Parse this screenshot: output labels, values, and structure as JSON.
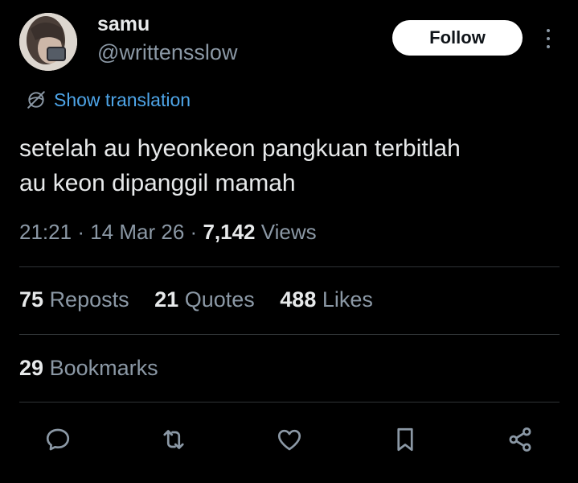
{
  "author": {
    "name": "samu",
    "handle": "@writtensslow",
    "avatar_icon": "profile-photo"
  },
  "follow_label": "Follow",
  "more_icon": "more-vertical-icon",
  "translation": {
    "label": "Show translation",
    "icon": "globe-slash-icon",
    "color": "#4ea5e8"
  },
  "tweet": {
    "line1": "setelah au hyeonkeon pangkuan terbitlah",
    "line2": "au keon dipanggil mamah"
  },
  "meta": {
    "time": "21:21",
    "sep": "·",
    "date": "14 Mar 26",
    "views_count": "7,142",
    "views_label": "Views"
  },
  "stats": {
    "reposts_count": "75",
    "reposts_label": "Reposts",
    "quotes_count": "21",
    "quotes_label": "Quotes",
    "likes_count": "488",
    "likes_label": "Likes",
    "bookmarks_count": "29",
    "bookmarks_label": "Bookmarks"
  },
  "actions": [
    "reply-icon",
    "repost-icon",
    "like-icon",
    "bookmark-icon",
    "share-icon"
  ],
  "colors": {
    "background": "#000000",
    "text": "#e7e9ea",
    "secondary": "#8b98a5",
    "divider": "#2f3336",
    "follow_bg": "#ffffff"
  }
}
